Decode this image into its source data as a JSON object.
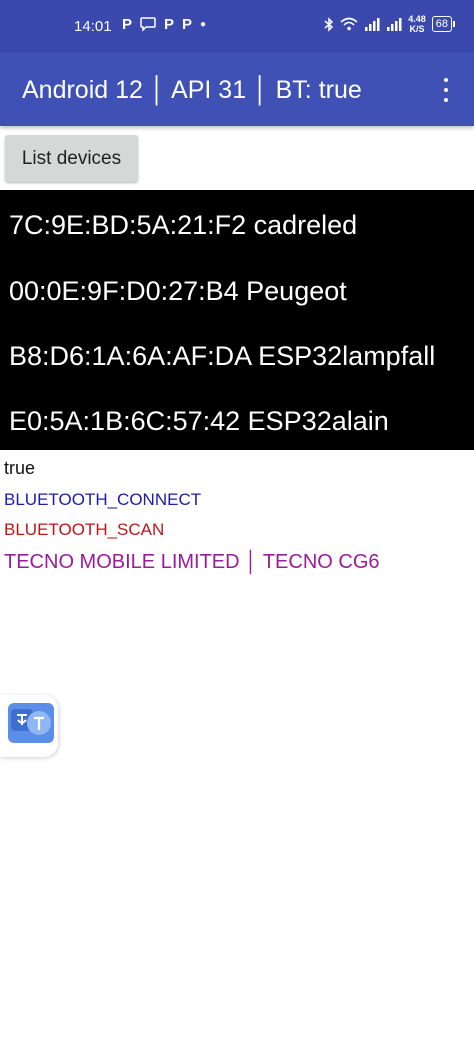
{
  "status_bar": {
    "time": "14:01",
    "notification_icons": [
      "P",
      "P",
      "P"
    ],
    "speed_value": "4.48",
    "speed_unit": "K/S",
    "battery": "68"
  },
  "app_bar": {
    "title": "Android 12 │ API 31 │ BT:  true"
  },
  "list_button": {
    "label": "List devices"
  },
  "devices": [
    "7C:9E:BD:5A:21:F2 cadreled",
    "00:0E:9F:D0:27:B4 Peugeot",
    "B8:D6:1A:6A:AF:DA ESP32lampfall",
    "E0:5A:1B:6C:57:42 ESP32alain"
  ],
  "status_lines": {
    "bluetooth_enabled": "true",
    "permission_connect": "BLUETOOTH_CONNECT",
    "permission_scan": "BLUETOOTH_SCAN",
    "manufacturer_model": "TECNO MOBILE LIMITED │ TECNO CG6"
  },
  "colors": {
    "status_bar": "#3b48ad",
    "app_bar": "#3f51b5",
    "list_bg": "#000000",
    "connect_text": "#1c1ca8",
    "scan_text": "#c0161a",
    "maker_text": "#9c1a9c"
  },
  "translate_bubble": {
    "icon": "translate-icon"
  }
}
